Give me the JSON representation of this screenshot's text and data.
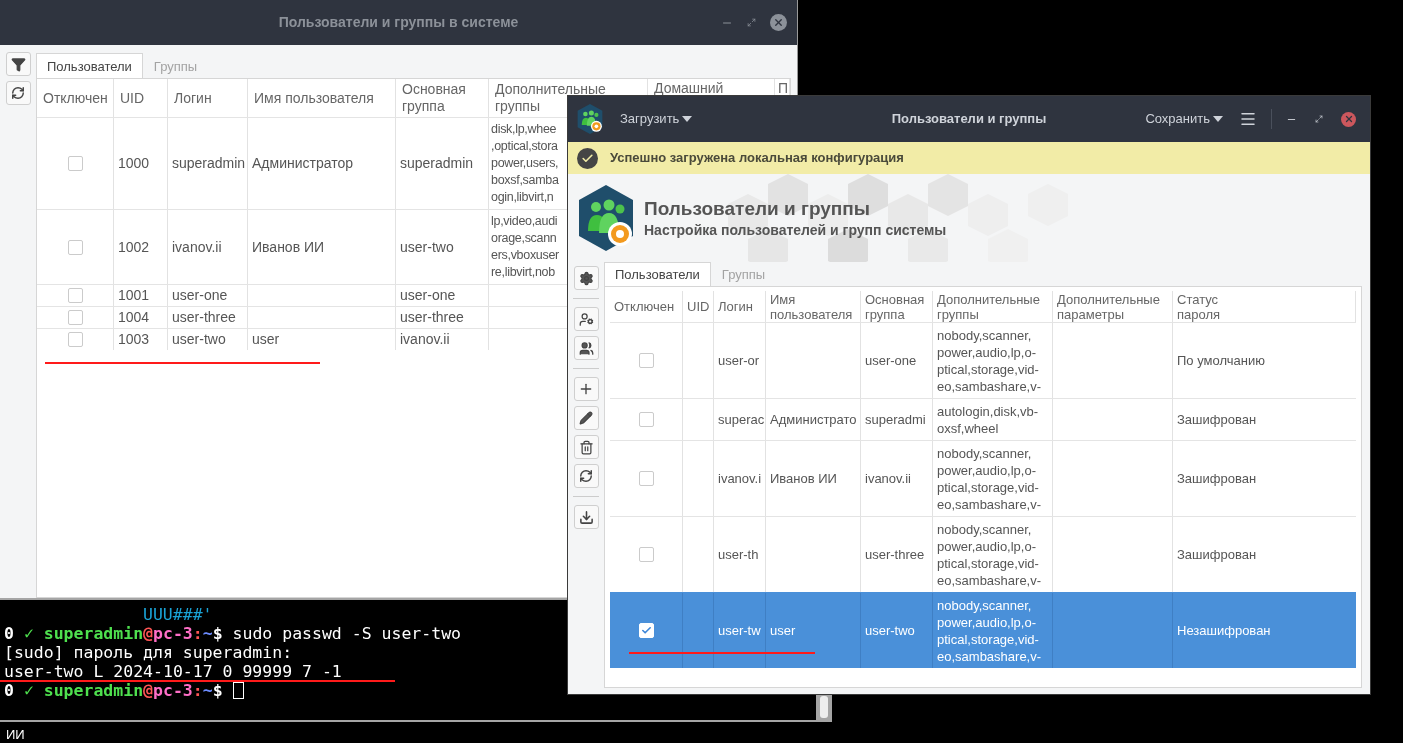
{
  "back_window": {
    "title": "Пользователи и группы в системе",
    "tabs": [
      {
        "label": "Пользователи",
        "selected": true
      },
      {
        "label": "Группы",
        "selected": false
      }
    ],
    "table": {
      "columns": [
        "Отключен",
        "UID",
        "Логин",
        "Имя пользователя",
        "Основная\nгруппа",
        "Дополнительные\nгруппы",
        "Домашний",
        "П"
      ],
      "rows": [
        {
          "checked": false,
          "uid": "1000",
          "login": "superadmin",
          "name": "Администратор",
          "group": "superadmin",
          "extra_groups": "disk,lp,whee\n,optical,stora\npower,users,\nboxsf,samba\nogin,libvirt,n"
        },
        {
          "checked": false,
          "uid": "1002",
          "login": "ivanov.ii",
          "name": "Иванов ИИ",
          "group": "user-two",
          "extra_groups": "lp,video,audi\norage,scann\ners,vboxuser\nre,libvirt,nob"
        },
        {
          "checked": false,
          "uid": "1001",
          "login": "user-one",
          "group": "user-one"
        },
        {
          "checked": false,
          "uid": "1004",
          "login": "user-three",
          "group": "user-three"
        },
        {
          "checked": false,
          "uid": "1003",
          "login": "user-two",
          "name": "user",
          "group": "ivanov.ii"
        }
      ]
    }
  },
  "terminal": {
    "lines": [
      {
        "kind": "art",
        "text": "UUU###'"
      },
      {
        "kind": "prompt",
        "status": "0",
        "check": "✓",
        "user": "superadmin",
        "at": "@",
        "host": "pc-3",
        "path": ":~$",
        "command": "sudo passwd -S user-two"
      },
      {
        "kind": "output",
        "text": "[sudo] пароль для superadmin:"
      },
      {
        "kind": "output",
        "text": "user-two L 2024-10-17 0 99999 7 -1"
      },
      {
        "kind": "prompt",
        "status": "0",
        "check": "✓",
        "user": "superadmin",
        "at": "@",
        "host": "pc-3",
        "path": ":~$",
        "cursor": true
      }
    ]
  },
  "desktop": {
    "bottom_text": "ИИ"
  },
  "front_window": {
    "title": "Пользователи и группы",
    "load_button": "Загрузить",
    "save_button": "Сохранить",
    "notice": "Успешно загружена локальная конфигурация",
    "header": {
      "title": "Пользователи и группы",
      "subtitle": "Настройка пользователей и групп системы"
    },
    "tabs": [
      {
        "label": "Пользователи",
        "selected": true
      },
      {
        "label": "Группы",
        "selected": false
      }
    ],
    "table": {
      "columns": [
        "Отключен",
        "UID",
        "Логин",
        "Имя\nпользователя",
        "Основная\nгруппа",
        "Дополнительные\nгруппы",
        "Дополнительные\nпараметры",
        "Статус\nпароля"
      ],
      "rows": [
        {
          "selected": false,
          "checked": false,
          "login": "user-or",
          "group": "user-one",
          "extra_groups": "nobody,scanner,\npower,audio,lp,o-\nptical,storage,vid-\neo,sambashare,v-",
          "password_status": "По умолчанию"
        },
        {
          "selected": false,
          "checked": false,
          "login": "superac",
          "name": "Администрато",
          "group": "superadmi",
          "extra_groups": "autologin,disk,vb-\noxsf,wheel",
          "password_status": "Зашифрован"
        },
        {
          "selected": false,
          "checked": false,
          "login": "ivanov.i",
          "name": "Иванов ИИ",
          "group": "ivanov.ii",
          "extra_groups": "nobody,scanner,\npower,audio,lp,o-\nptical,storage,vid-\neo,sambashare,v-",
          "password_status": "Зашифрован"
        },
        {
          "selected": false,
          "checked": false,
          "login": "user-th",
          "group": "user-three",
          "extra_groups": "nobody,scanner,\npower,audio,lp,o-\nptical,storage,vid-\neo,sambashare,v-",
          "password_status": "Зашифрован"
        },
        {
          "selected": true,
          "checked": true,
          "login": "user-tw",
          "name": "user",
          "group": "user-two",
          "extra_groups": "nobody,scanner,\npower,audio,lp,o-\nptical,storage,vid-\neo,sambashare,v-",
          "password_status": "Незашифрован"
        }
      ]
    }
  }
}
